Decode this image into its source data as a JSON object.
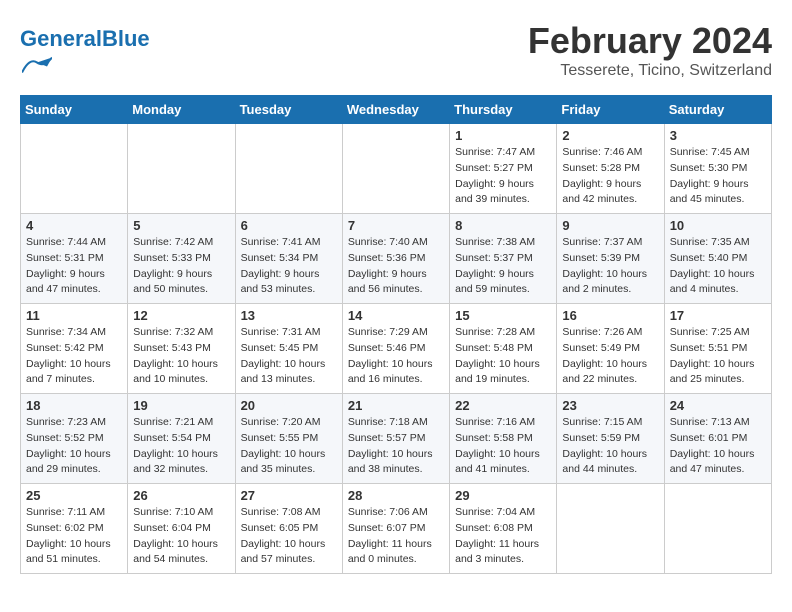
{
  "header": {
    "logo_text_general": "General",
    "logo_text_blue": "Blue",
    "month_title": "February 2024",
    "subtitle": "Tesserete, Ticino, Switzerland"
  },
  "days_of_week": [
    "Sunday",
    "Monday",
    "Tuesday",
    "Wednesday",
    "Thursday",
    "Friday",
    "Saturday"
  ],
  "weeks": [
    [
      {
        "day": "",
        "info": ""
      },
      {
        "day": "",
        "info": ""
      },
      {
        "day": "",
        "info": ""
      },
      {
        "day": "",
        "info": ""
      },
      {
        "day": "1",
        "info": "Sunrise: 7:47 AM\nSunset: 5:27 PM\nDaylight: 9 hours\nand 39 minutes."
      },
      {
        "day": "2",
        "info": "Sunrise: 7:46 AM\nSunset: 5:28 PM\nDaylight: 9 hours\nand 42 minutes."
      },
      {
        "day": "3",
        "info": "Sunrise: 7:45 AM\nSunset: 5:30 PM\nDaylight: 9 hours\nand 45 minutes."
      }
    ],
    [
      {
        "day": "4",
        "info": "Sunrise: 7:44 AM\nSunset: 5:31 PM\nDaylight: 9 hours\nand 47 minutes."
      },
      {
        "day": "5",
        "info": "Sunrise: 7:42 AM\nSunset: 5:33 PM\nDaylight: 9 hours\nand 50 minutes."
      },
      {
        "day": "6",
        "info": "Sunrise: 7:41 AM\nSunset: 5:34 PM\nDaylight: 9 hours\nand 53 minutes."
      },
      {
        "day": "7",
        "info": "Sunrise: 7:40 AM\nSunset: 5:36 PM\nDaylight: 9 hours\nand 56 minutes."
      },
      {
        "day": "8",
        "info": "Sunrise: 7:38 AM\nSunset: 5:37 PM\nDaylight: 9 hours\nand 59 minutes."
      },
      {
        "day": "9",
        "info": "Sunrise: 7:37 AM\nSunset: 5:39 PM\nDaylight: 10 hours\nand 2 minutes."
      },
      {
        "day": "10",
        "info": "Sunrise: 7:35 AM\nSunset: 5:40 PM\nDaylight: 10 hours\nand 4 minutes."
      }
    ],
    [
      {
        "day": "11",
        "info": "Sunrise: 7:34 AM\nSunset: 5:42 PM\nDaylight: 10 hours\nand 7 minutes."
      },
      {
        "day": "12",
        "info": "Sunrise: 7:32 AM\nSunset: 5:43 PM\nDaylight: 10 hours\nand 10 minutes."
      },
      {
        "day": "13",
        "info": "Sunrise: 7:31 AM\nSunset: 5:45 PM\nDaylight: 10 hours\nand 13 minutes."
      },
      {
        "day": "14",
        "info": "Sunrise: 7:29 AM\nSunset: 5:46 PM\nDaylight: 10 hours\nand 16 minutes."
      },
      {
        "day": "15",
        "info": "Sunrise: 7:28 AM\nSunset: 5:48 PM\nDaylight: 10 hours\nand 19 minutes."
      },
      {
        "day": "16",
        "info": "Sunrise: 7:26 AM\nSunset: 5:49 PM\nDaylight: 10 hours\nand 22 minutes."
      },
      {
        "day": "17",
        "info": "Sunrise: 7:25 AM\nSunset: 5:51 PM\nDaylight: 10 hours\nand 25 minutes."
      }
    ],
    [
      {
        "day": "18",
        "info": "Sunrise: 7:23 AM\nSunset: 5:52 PM\nDaylight: 10 hours\nand 29 minutes."
      },
      {
        "day": "19",
        "info": "Sunrise: 7:21 AM\nSunset: 5:54 PM\nDaylight: 10 hours\nand 32 minutes."
      },
      {
        "day": "20",
        "info": "Sunrise: 7:20 AM\nSunset: 5:55 PM\nDaylight: 10 hours\nand 35 minutes."
      },
      {
        "day": "21",
        "info": "Sunrise: 7:18 AM\nSunset: 5:57 PM\nDaylight: 10 hours\nand 38 minutes."
      },
      {
        "day": "22",
        "info": "Sunrise: 7:16 AM\nSunset: 5:58 PM\nDaylight: 10 hours\nand 41 minutes."
      },
      {
        "day": "23",
        "info": "Sunrise: 7:15 AM\nSunset: 5:59 PM\nDaylight: 10 hours\nand 44 minutes."
      },
      {
        "day": "24",
        "info": "Sunrise: 7:13 AM\nSunset: 6:01 PM\nDaylight: 10 hours\nand 47 minutes."
      }
    ],
    [
      {
        "day": "25",
        "info": "Sunrise: 7:11 AM\nSunset: 6:02 PM\nDaylight: 10 hours\nand 51 minutes."
      },
      {
        "day": "26",
        "info": "Sunrise: 7:10 AM\nSunset: 6:04 PM\nDaylight: 10 hours\nand 54 minutes."
      },
      {
        "day": "27",
        "info": "Sunrise: 7:08 AM\nSunset: 6:05 PM\nDaylight: 10 hours\nand 57 minutes."
      },
      {
        "day": "28",
        "info": "Sunrise: 7:06 AM\nSunset: 6:07 PM\nDaylight: 11 hours\nand 0 minutes."
      },
      {
        "day": "29",
        "info": "Sunrise: 7:04 AM\nSunset: 6:08 PM\nDaylight: 11 hours\nand 3 minutes."
      },
      {
        "day": "",
        "info": ""
      },
      {
        "day": "",
        "info": ""
      }
    ]
  ]
}
